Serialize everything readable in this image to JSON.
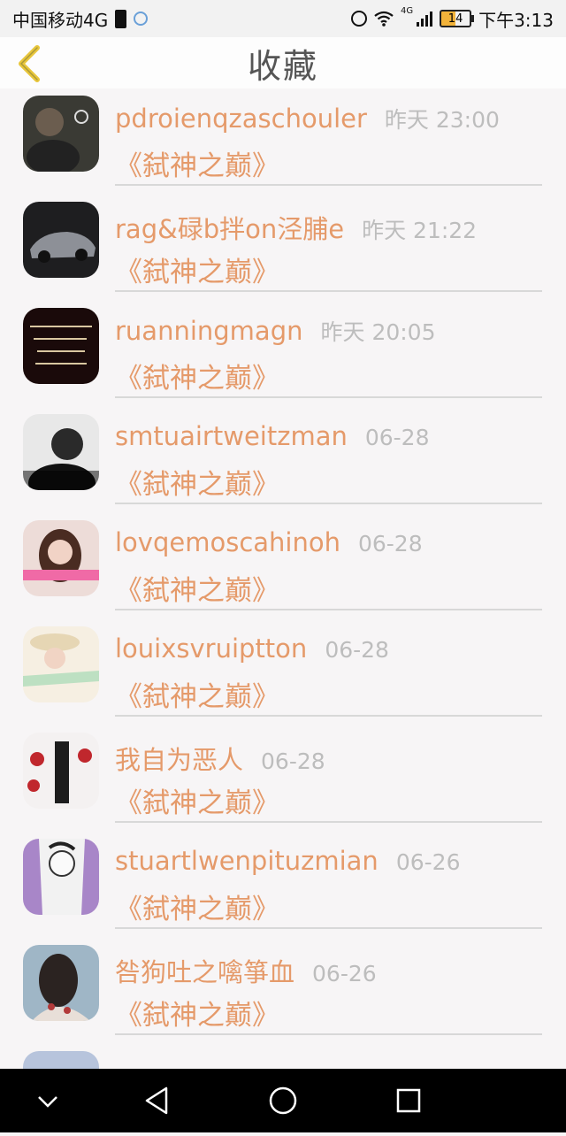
{
  "status_bar": {
    "carrier": "中国移动4G",
    "network_small": "4G",
    "battery": "14",
    "time": "下午3:13"
  },
  "header": {
    "title": "收藏"
  },
  "items": [
    {
      "username": "pdroienqzaschouler",
      "time": "昨天 23:00",
      "book": "《弑神之巅》"
    },
    {
      "username": "rag&碌b拌on泾脯e",
      "time": "昨天 21:22",
      "book": "《弑神之巅》"
    },
    {
      "username": "ruanningmagn",
      "time": "昨天 20:05",
      "book": "《弑神之巅》"
    },
    {
      "username": "smtuairtweitzman",
      "time": "06-28",
      "book": "《弑神之巅》"
    },
    {
      "username": "lovqemoscahinoh",
      "time": "06-28",
      "book": "《弑神之巅》"
    },
    {
      "username": "louixsvruiptton",
      "time": "06-28",
      "book": "《弑神之巅》"
    },
    {
      "username": "我自为恶人",
      "time": "06-28",
      "book": "《弑神之巅》"
    },
    {
      "username": "stuartlwenpituzmian",
      "time": "06-26",
      "book": "《弑神之巅》"
    },
    {
      "username": "咎狗吐之噙箏血",
      "time": "06-26",
      "book": "《弑神之巅》"
    }
  ],
  "colors": {
    "accent": "#e59a6a",
    "time_gray": "#bdbdbd",
    "back_arrow": "#e8c63b"
  }
}
